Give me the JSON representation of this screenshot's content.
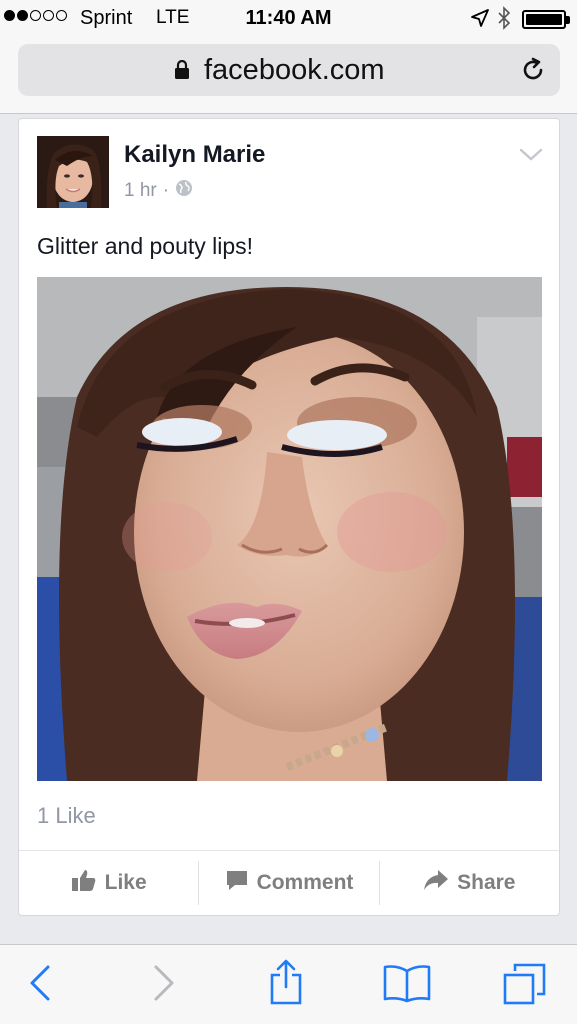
{
  "status_bar": {
    "carrier": "Sprint",
    "network": "LTE",
    "time": "11:40 AM"
  },
  "browser": {
    "url": "facebook.com"
  },
  "post": {
    "author": "Kailyn Marie",
    "timestamp": "1 hr",
    "separator": "·",
    "privacy_icon": "globe-icon",
    "text": "Glitter and pouty lips!",
    "likes_count": "1 Like",
    "actions": {
      "like": "Like",
      "comment": "Comment",
      "share": "Share"
    }
  },
  "colors": {
    "facebook_text": "#141823",
    "meta_gray": "#9197a3",
    "ios_blue": "#1f7cf6"
  }
}
